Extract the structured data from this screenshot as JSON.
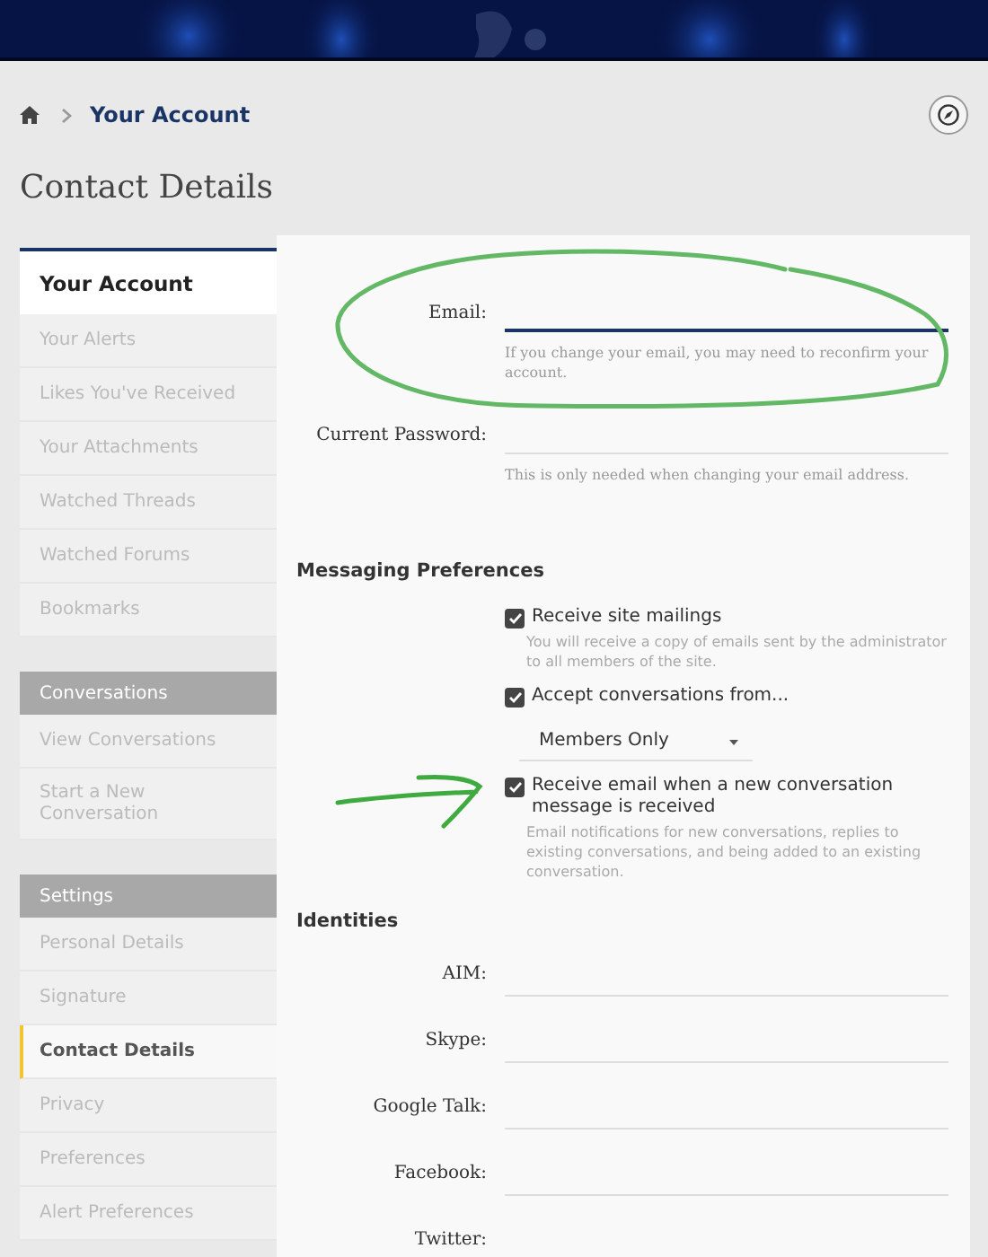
{
  "breadcrumb": {
    "items": [
      {
        "label": "Your Account"
      }
    ]
  },
  "page_title": "Contact Details",
  "sidebar": {
    "sections": [
      {
        "title": "Your Account",
        "kind": "primary",
        "items": [
          {
            "label": "Your Alerts",
            "selected": false
          },
          {
            "label": "Likes You've Received",
            "selected": false
          },
          {
            "label": "Your Attachments",
            "selected": false
          },
          {
            "label": "Watched Threads",
            "selected": false
          },
          {
            "label": "Watched Forums",
            "selected": false
          },
          {
            "label": "Bookmarks",
            "selected": false
          }
        ]
      },
      {
        "title": "Conversations",
        "kind": "group",
        "items": [
          {
            "label": "View Conversations",
            "selected": false
          },
          {
            "label": "Start a New Conversation",
            "selected": false
          }
        ]
      },
      {
        "title": "Settings",
        "kind": "group",
        "items": [
          {
            "label": "Personal Details",
            "selected": false
          },
          {
            "label": "Signature",
            "selected": false
          },
          {
            "label": "Contact Details",
            "selected": true
          },
          {
            "label": "Privacy",
            "selected": false
          },
          {
            "label": "Preferences",
            "selected": false
          },
          {
            "label": "Alert Preferences",
            "selected": false
          }
        ]
      }
    ]
  },
  "account_fields": [
    {
      "label": "Email:",
      "focused": true,
      "hint": "If you change your email, you may need to reconfirm your account."
    },
    {
      "label": "Current Password:",
      "focused": false,
      "hint": "This is only needed when changing your email address."
    }
  ],
  "messaging": {
    "title": "Messaging Preferences",
    "options": [
      {
        "label": "Receive site mailings",
        "checked": true,
        "hint": "You will receive a copy of emails sent by the administrator to all members of the site."
      },
      {
        "label": "Accept conversations from...",
        "checked": true,
        "select": {
          "value": "Members Only"
        }
      },
      {
        "label": "Receive email when a new conversation message is received",
        "checked": true,
        "hint": "Email notifications for new conversations, replies to existing conversations, and being added to an existing conversation."
      }
    ]
  },
  "identities": {
    "title": "Identities",
    "fields": [
      {
        "label": "AIM:"
      },
      {
        "label": "Skype:"
      },
      {
        "label": "Google Talk:"
      },
      {
        "label": "Facebook:"
      },
      {
        "label": "Twitter:"
      }
    ]
  }
}
